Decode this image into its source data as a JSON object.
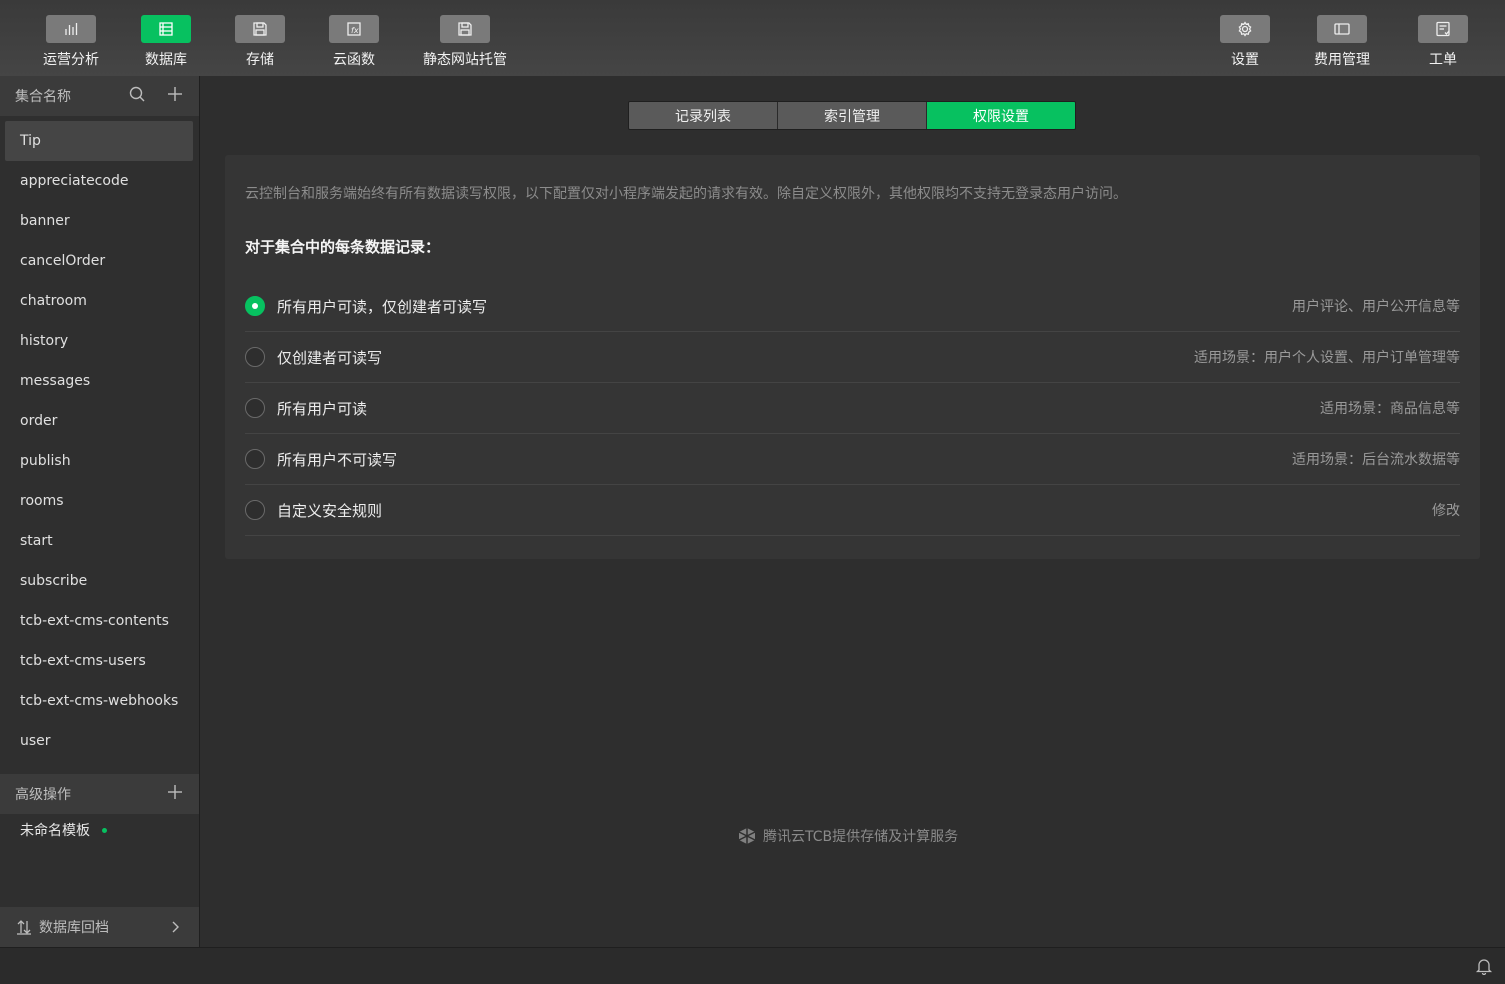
{
  "toolbar": {
    "left": [
      {
        "label": "运营分析",
        "icon": "bar-chart-icon"
      },
      {
        "label": "数据库",
        "icon": "database-icon"
      },
      {
        "label": "存储",
        "icon": "storage-icon"
      },
      {
        "label": "云函数",
        "icon": "function-icon"
      },
      {
        "label": "静态网站托管",
        "icon": "static-hosting-icon"
      }
    ],
    "right": [
      {
        "label": "设置",
        "icon": "gear-icon"
      },
      {
        "label": "费用管理",
        "icon": "billing-icon"
      },
      {
        "label": "工单",
        "icon": "ticket-icon"
      }
    ],
    "active_index": 1
  },
  "sidebar": {
    "header": "集合名称",
    "collections": [
      "Tip",
      "appreciatecode",
      "banner",
      "cancelOrder",
      "chatroom",
      "history",
      "messages",
      "order",
      "publish",
      "rooms",
      "start",
      "subscribe",
      "tcb-ext-cms-contents",
      "tcb-ext-cms-users",
      "tcb-ext-cms-webhooks",
      "user"
    ],
    "active_collection": "Tip",
    "advanced_header": "高级操作",
    "advanced_items": [
      "未命名模板"
    ],
    "rollback_label": "数据库回档"
  },
  "main": {
    "tabs": [
      "记录列表",
      "索引管理",
      "权限设置"
    ],
    "active_tab": 2,
    "notice": "云控制台和服务端始终有所有数据读写权限，以下配置仅对小程序端发起的请求有效。除自定义权限外，其他权限均不支持无登录态用户访问。",
    "section_title": "对于集合中的每条数据记录：",
    "options": [
      {
        "label": "所有用户可读，仅创建者可读写",
        "desc": "用户评论、用户公开信息等",
        "checked": true
      },
      {
        "label": "仅创建者可读写",
        "desc": "适用场景：用户个人设置、用户订单管理等",
        "checked": false
      },
      {
        "label": "所有用户可读",
        "desc": "适用场景：商品信息等",
        "checked": false
      },
      {
        "label": "所有用户不可读写",
        "desc": "适用场景：后台流水数据等",
        "checked": false
      },
      {
        "label": "自定义安全规则",
        "desc": "修改",
        "checked": false
      }
    ]
  },
  "footer": {
    "brand_text": "腾讯云TCB提供存储及计算服务"
  },
  "colors": {
    "accent": "#07c160",
    "background": "#2e2e2e",
    "panel": "#353535"
  }
}
